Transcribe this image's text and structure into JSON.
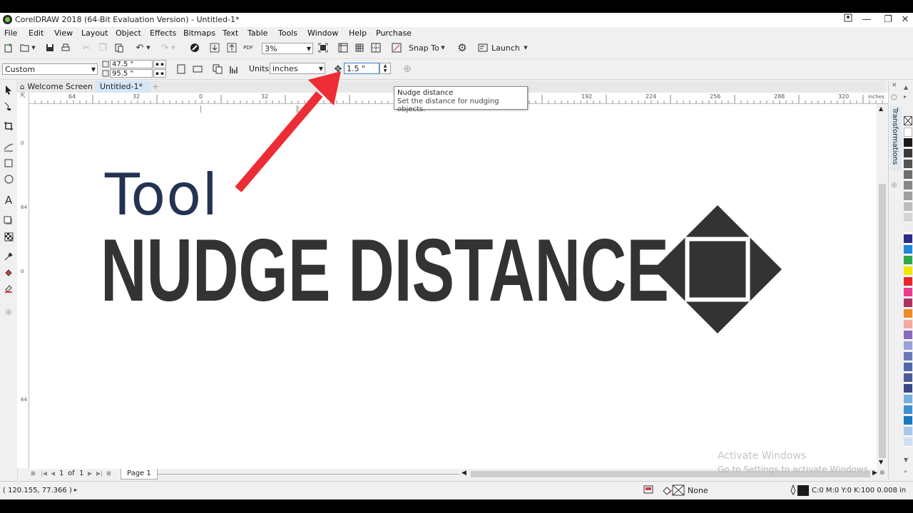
{
  "window": {
    "title": "CorelDRAW 2018 (64-Bit Evaluation Version) - Untitled-1*",
    "minimize": "—",
    "restore": "❐",
    "close": "✕"
  },
  "menu": [
    "File",
    "Edit",
    "View",
    "Layout",
    "Object",
    "Effects",
    "Bitmaps",
    "Text",
    "Table",
    "Tools",
    "Window",
    "Help",
    "Purchase"
  ],
  "toolbar1": {
    "zoom_value": "3%",
    "snap_label": "Snap To",
    "launch_label": "Launch"
  },
  "toolbar2": {
    "page_preset": "Custom",
    "width_value": "47.5 \"",
    "height_value": "95.5 \"",
    "units_label": "Units:",
    "units_value": "inches",
    "nudge_value": "1.5 \""
  },
  "tabs": {
    "welcome": "Welcome Screen",
    "document": "Untitled-1*",
    "add": "+"
  },
  "ruler": {
    "top_labels": [
      "64",
      "32",
      "0",
      "32",
      "192",
      "224",
      "256",
      "288",
      "320",
      "inches"
    ],
    "left_labels": [
      "0",
      "64",
      "0",
      "64"
    ]
  },
  "tooltip": {
    "title": "Nudge distance",
    "description": "Set the distance for nudging objects."
  },
  "canvas": {
    "tool_word": "Tool",
    "headline": "NUDGE DISTANCE",
    "tool_color": "#253352",
    "headline_color": "#333333",
    "arrow_color": "#ed2d35"
  },
  "pagebar": {
    "page_current": "1",
    "of_label": "of",
    "page_total": "1",
    "page_tab": "Page 1"
  },
  "watermark": {
    "line1": "Activate Windows",
    "line2": "Go to Settings to activate Windows."
  },
  "dock": {
    "panel_label": "Transformations"
  },
  "status": {
    "coordinates": "( 120.155, 77.366 )",
    "fill_label": "None",
    "outline_info": "C:0 M:0 Y:0 K:100  0.008 in"
  },
  "palette_colors": [
    "#ffffff",
    "#1a1a1a",
    "#3a3a3a",
    "#555555",
    "#6e6e6e",
    "#888888",
    "#a0a0a0",
    "#bcbcbc",
    "#d4d4d4",
    "#ececec",
    "#2d2d8a",
    "#1e88d8",
    "#2ea84a",
    "#f3e600",
    "#e8242c",
    "#e83e8c",
    "#b03060",
    "#f08a24",
    "#f4a8a0",
    "#8b6bb8",
    "#9aa0d8",
    "#6c7ab8",
    "#5068a8",
    "#4a5a98",
    "#3a4a88",
    "#7ab0e0",
    "#4090d0",
    "#1878c0",
    "#a8c8e8",
    "#d0e0f0"
  ]
}
